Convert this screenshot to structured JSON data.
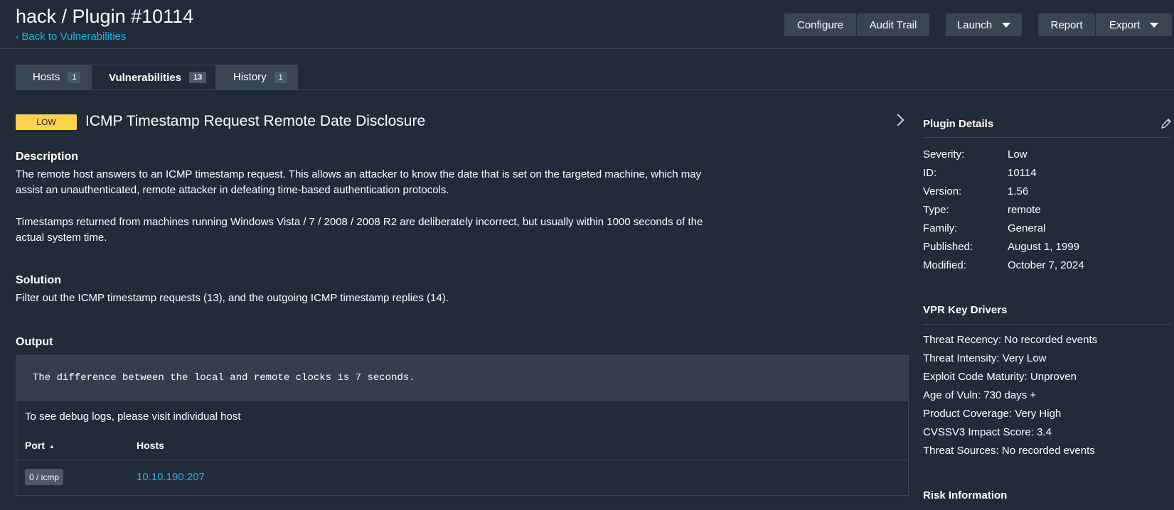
{
  "header": {
    "title": "hack / Plugin #10114",
    "back_label": "Back to Vulnerabilities",
    "buttons": {
      "configure": "Configure",
      "audit_trail": "Audit Trail",
      "launch": "Launch",
      "report": "Report",
      "export": "Export"
    }
  },
  "tabs": [
    {
      "label": "Hosts",
      "count": "1"
    },
    {
      "label": "Vulnerabilities",
      "count": "13"
    },
    {
      "label": "History",
      "count": "1"
    }
  ],
  "vuln": {
    "severity": "LOW",
    "title": "ICMP Timestamp Request Remote Date Disclosure",
    "description_heading": "Description",
    "description_p1": "The remote host answers to an ICMP timestamp request. This allows an attacker to know the date that is set on the targeted machine, which may assist an unauthenticated, remote attacker in defeating time-based authentication protocols.",
    "description_p2": "Timestamps returned from machines running Windows Vista / 7 / 2008 / 2008 R2 are deliberately incorrect, but usually within 1000 seconds of the actual system time.",
    "solution_heading": "Solution",
    "solution": "Filter out the ICMP timestamp requests (13), and the outgoing ICMP timestamp replies (14).",
    "output_heading": "Output",
    "output_text": "The difference between the local and remote clocks is 7 seconds.",
    "debug_note": "To see debug logs, please visit individual host",
    "table": {
      "col_port": "Port",
      "col_hosts": "Hosts",
      "rows": [
        {
          "port": "0 / icmp",
          "host": "10.10.190.207"
        }
      ]
    }
  },
  "sidebar": {
    "plugin_details_heading": "Plugin Details",
    "details": [
      {
        "label": "Severity:",
        "value": "Low"
      },
      {
        "label": "ID:",
        "value": "10114"
      },
      {
        "label": "Version:",
        "value": "1.56"
      },
      {
        "label": "Type:",
        "value": "remote"
      },
      {
        "label": "Family:",
        "value": "General"
      },
      {
        "label": "Published:",
        "value": "August 1, 1999"
      },
      {
        "label": "Modified:",
        "value": "October 7, 2024"
      }
    ],
    "vpr_heading": "VPR Key Drivers",
    "vpr_drivers": [
      "Threat Recency: No recorded events",
      "Threat Intensity: Very Low",
      "Exploit Code Maturity: Unproven",
      "Age of Vuln: 730 days +",
      "Product Coverage: Very High",
      "CVSSV3 Impact Score: 3.4",
      "Threat Sources: No recorded events"
    ],
    "risk_heading": "Risk Information"
  },
  "colors": {
    "background": "#222b38",
    "accent_link": "#1ab7e0",
    "severity_low": "#ffd24d",
    "button": "#3a4554"
  }
}
